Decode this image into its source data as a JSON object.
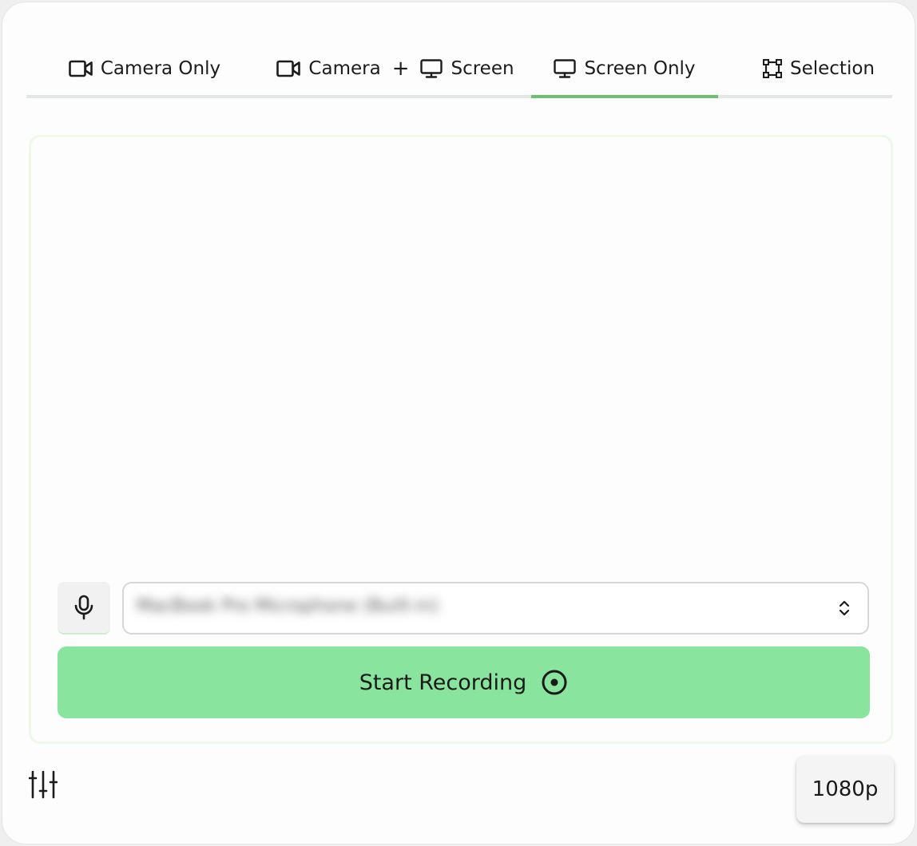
{
  "tabs": [
    {
      "label": "Camera Only",
      "icon": "video-camera-icon"
    },
    {
      "label_a": "Camera",
      "plus": "+",
      "label_b": "Screen",
      "icons": [
        "video-camera-icon",
        "monitor-icon"
      ]
    },
    {
      "label": "Screen Only",
      "icon": "monitor-icon",
      "active": true
    },
    {
      "label": "Selection",
      "icon": "selection-frame-icon"
    }
  ],
  "microphone": {
    "icon": "microphone-icon",
    "selected_device": "MacBook Pro Microphone (Built-in)"
  },
  "start_button": {
    "label": "Start Recording",
    "icon": "record-circle-icon"
  },
  "footer": {
    "settings_icon": "sliders-icon",
    "resolution": "1080p"
  },
  "colors": {
    "accent": "#6dc071",
    "start_button_bg": "#89e49d",
    "panel_border": "#eef8e8"
  }
}
